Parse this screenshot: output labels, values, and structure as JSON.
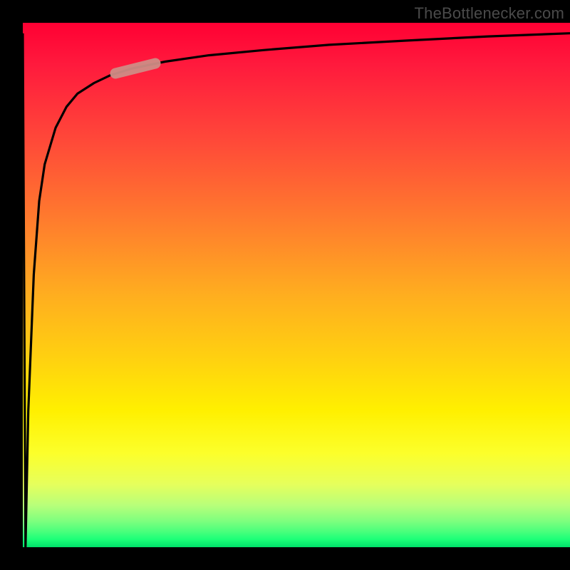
{
  "watermark": {
    "text": "TheBottlenecker.com"
  },
  "colors": {
    "frame": "#000000",
    "curve": "#000000",
    "marker": "#cf8c85",
    "gradient_stops": [
      "#ff0033",
      "#ff4739",
      "#ff7d2d",
      "#ffae1f",
      "#ffd110",
      "#fff000",
      "#b8ff7a",
      "#1cff78"
    ]
  },
  "chart_data": {
    "type": "line",
    "title": "",
    "xlabel": "",
    "ylabel": "",
    "xlim": [
      0,
      100
    ],
    "ylim": [
      0,
      100
    ],
    "grid": false,
    "legend": false,
    "series": [
      {
        "name": "bottleneck-curve",
        "description": "sharp spike down at x≈0 to y≈0, then rapid rise toward y≈100 saturating across x",
        "x": [
          0,
          0.5,
          1,
          2,
          3,
          4,
          6,
          8,
          10,
          13,
          16,
          20,
          26,
          34,
          44,
          56,
          70,
          85,
          100
        ],
        "y": [
          98,
          0,
          26,
          52,
          66,
          73,
          80,
          84,
          86.5,
          88.5,
          90,
          91.3,
          92.6,
          93.8,
          94.8,
          95.8,
          96.6,
          97.4,
          98
        ]
      }
    ],
    "marker": {
      "name": "highlight-segment",
      "x_range": [
        17,
        24
      ],
      "y_range": [
        90.5,
        92.3
      ]
    }
  }
}
